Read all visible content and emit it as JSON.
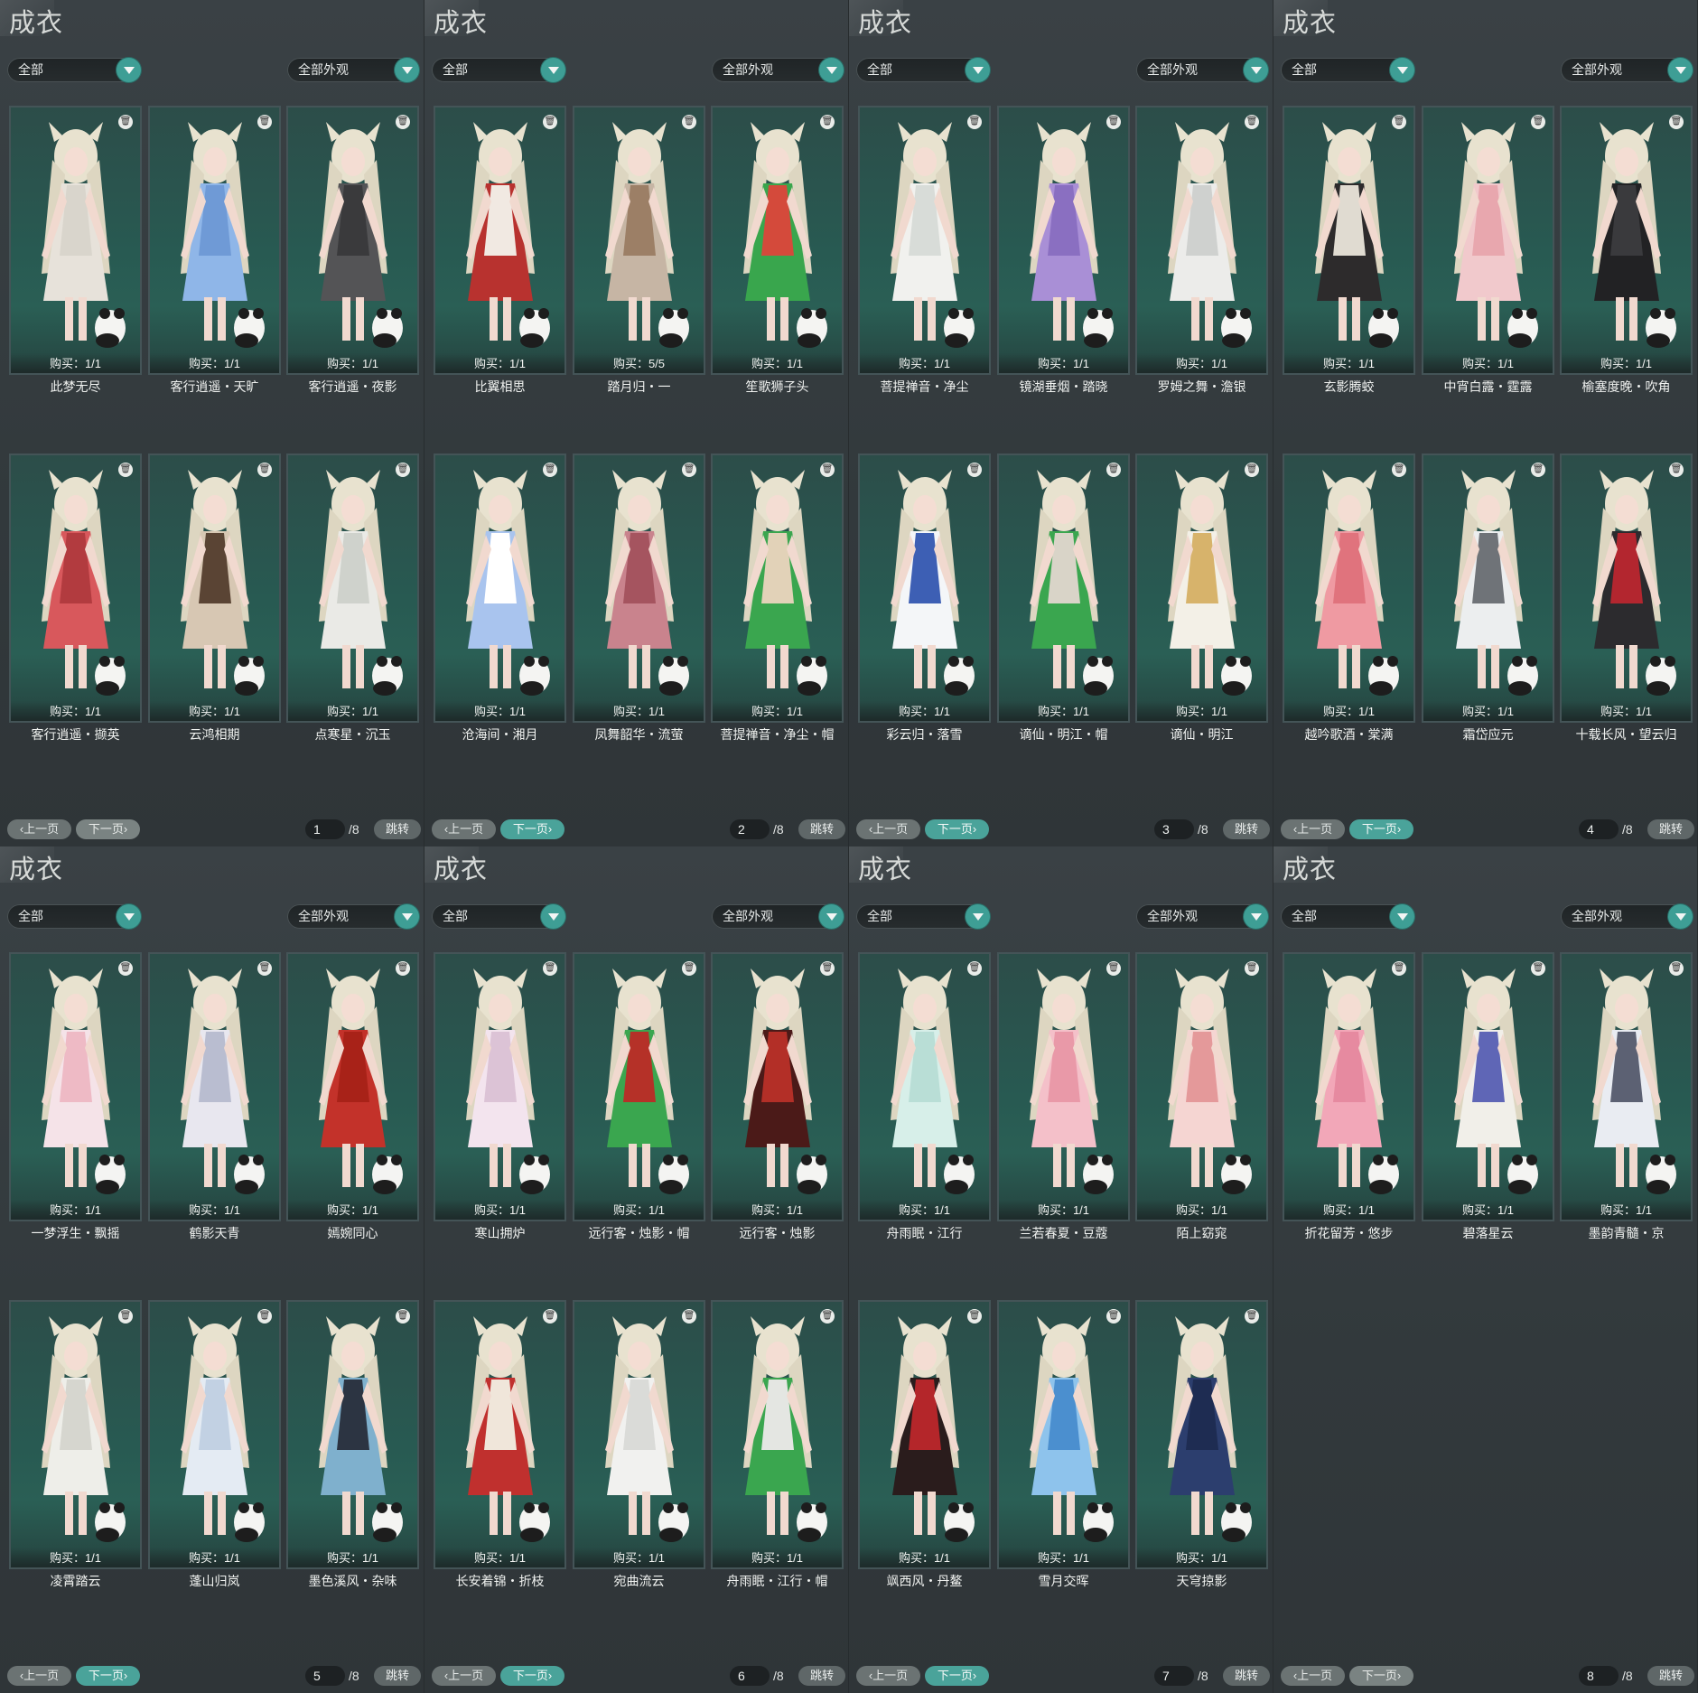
{
  "panels": [
    {
      "title": "成衣",
      "filter_left": "全部",
      "filter_right": "全部外观",
      "prev_label": "上一页",
      "next_label": "下一页",
      "page": "1",
      "total": "/8",
      "jump_label": "跳转",
      "next_active": false,
      "items": [
        {
          "name": "此梦无尽",
          "buy": "购买：1/1",
          "colors": [
            "#e7e2da",
            "#d9d5cc"
          ]
        },
        {
          "name": "客行逍遥・天旷",
          "buy": "购买：1/1",
          "colors": [
            "#8fb6e8",
            "#6f9ad6"
          ]
        },
        {
          "name": "客行逍遥・夜影",
          "buy": "购买：1/1",
          "colors": [
            "#545456",
            "#3a3a3c"
          ]
        },
        {
          "name": "客行逍遥・撷英",
          "buy": "购买：1/1",
          "colors": [
            "#d8585c",
            "#b23b3f"
          ]
        },
        {
          "name": "云鸿相期",
          "buy": "购买：1/1",
          "colors": [
            "#d7c7b3",
            "#5a4434"
          ]
        },
        {
          "name": "点寒星・沉玉",
          "buy": "购买：1/1",
          "colors": [
            "#eaeae6",
            "#cfd2cc"
          ]
        }
      ]
    },
    {
      "title": "成衣",
      "filter_left": "全部",
      "filter_right": "全部外观",
      "prev_label": "上一页",
      "next_label": "下一页",
      "page": "2",
      "total": "/8",
      "jump_label": "跳转",
      "next_active": true,
      "items": [
        {
          "name": "比翼相思",
          "buy": "购买：1/1",
          "colors": [
            "#b8322f",
            "#f1e9e2"
          ]
        },
        {
          "name": "踏月归・一",
          "buy": "购买：5/5",
          "colors": [
            "#c6b5a4",
            "#9c7f66"
          ]
        },
        {
          "name": "笙歌狮子头",
          "buy": "购买：1/1",
          "colors": [
            "#39a64d",
            "#d44a3b"
          ]
        },
        {
          "name": "沧海间・湘月",
          "buy": "购买：1/1",
          "colors": [
            "#a9c4ee",
            "#ffffff"
          ]
        },
        {
          "name": "凤舞韶华・流萤",
          "buy": "购买：1/1",
          "colors": [
            "#c9838d",
            "#a5545f"
          ]
        },
        {
          "name": "菩提禅音・净尘・帽",
          "buy": "购买：1/1",
          "colors": [
            "#3aa64f",
            "#e2d2b8"
          ]
        }
      ]
    },
    {
      "title": "成衣",
      "filter_left": "全部",
      "filter_right": "全部外观",
      "prev_label": "上一页",
      "next_label": "下一页",
      "page": "3",
      "total": "/8",
      "jump_label": "跳转",
      "next_active": true,
      "items": [
        {
          "name": "菩提禅音・净尘",
          "buy": "购买：1/1",
          "colors": [
            "#f1f1ee",
            "#d8dcd8"
          ]
        },
        {
          "name": "镜湖垂烟・踏晓",
          "buy": "购买：1/1",
          "colors": [
            "#a98fd6",
            "#8a6fc1"
          ]
        },
        {
          "name": "罗姆之舞・澹银",
          "buy": "购买：1/1",
          "colors": [
            "#ececea",
            "#cfd1cf"
          ]
        },
        {
          "name": "彩云归・落雪",
          "buy": "购买：1/1",
          "colors": [
            "#f4f6f8",
            "#3d5fb4"
          ]
        },
        {
          "name": "谪仙・明江・帽",
          "buy": "购买：1/1",
          "colors": [
            "#3aa64f",
            "#d9d4c8"
          ]
        },
        {
          "name": "谪仙・明江",
          "buy": "购买：1/1",
          "colors": [
            "#f3f0e7",
            "#d7b36b"
          ]
        }
      ]
    },
    {
      "title": "成衣",
      "filter_left": "全部",
      "filter_right": "全部外观",
      "prev_label": "上一页",
      "next_label": "下一页",
      "page": "4",
      "total": "/8",
      "jump_label": "跳转",
      "next_active": true,
      "items": [
        {
          "name": "玄影腾蛟",
          "buy": "购买：1/1",
          "colors": [
            "#2d2b2c",
            "#e0dbd1"
          ]
        },
        {
          "name": "中宵白露・霆露",
          "buy": "购买：1/1",
          "colors": [
            "#f1c9cc",
            "#e8a7ae"
          ]
        },
        {
          "name": "榆塞度晚・吹角",
          "buy": "购买：1/1",
          "colors": [
            "#222224",
            "#3a3a3d"
          ]
        },
        {
          "name": "越吟歌酒・棠满",
          "buy": "购买：1/1",
          "colors": [
            "#ef9aa2",
            "#e0737d"
          ]
        },
        {
          "name": "霜岱应元",
          "buy": "购买：1/1",
          "colors": [
            "#eceeef",
            "#6f7378"
          ]
        },
        {
          "name": "十载长风・望云归",
          "buy": "购买：1/1",
          "colors": [
            "#2c2b2e",
            "#b3262f"
          ]
        }
      ]
    },
    {
      "title": "成衣",
      "filter_left": "全部",
      "filter_right": "全部外观",
      "prev_label": "上一页",
      "next_label": "下一页",
      "page": "5",
      "total": "/8",
      "jump_label": "跳转",
      "next_active": true,
      "items": [
        {
          "name": "一梦浮生・飘摇",
          "buy": "购买：1/1",
          "colors": [
            "#f5e3e8",
            "#eebac5"
          ]
        },
        {
          "name": "鹤影天青",
          "buy": "购买：1/1",
          "colors": [
            "#e8e7ef",
            "#b9bdd0"
          ]
        },
        {
          "name": "嫣婉同心",
          "buy": "购买：1/1",
          "colors": [
            "#c3322a",
            "#a82218"
          ]
        },
        {
          "name": "凌霄踏云",
          "buy": "购买：1/1",
          "colors": [
            "#eeeee9",
            "#d6d6cf"
          ]
        },
        {
          "name": "蓬山归岚",
          "buy": "购买：1/1",
          "colors": [
            "#e4ebf3",
            "#c2d1e3"
          ]
        },
        {
          "name": "墨色溪风・杂味",
          "buy": "购买：1/1",
          "colors": [
            "#7fb0cd",
            "#2c3442"
          ]
        }
      ]
    },
    {
      "title": "成衣",
      "filter_left": "全部",
      "filter_right": "全部外观",
      "prev_label": "上一页",
      "next_label": "下一页",
      "page": "6",
      "total": "/8",
      "jump_label": "跳转",
      "next_active": true,
      "items": [
        {
          "name": "寒山拥炉",
          "buy": "购买：1/1",
          "colors": [
            "#f3e4ee",
            "#dcc3d6"
          ]
        },
        {
          "name": "远行客・烛影・帽",
          "buy": "购买：1/1",
          "colors": [
            "#3aa64f",
            "#b53128"
          ]
        },
        {
          "name": "远行客・烛影",
          "buy": "购买：1/1",
          "colors": [
            "#4b1a18",
            "#b32f27"
          ]
        },
        {
          "name": "长安着锦・折枝",
          "buy": "购买：1/1",
          "colors": [
            "#c0302e",
            "#f0e6da"
          ]
        },
        {
          "name": "宛曲流云",
          "buy": "购买：1/1",
          "colors": [
            "#f1f1ef",
            "#dadbd8"
          ]
        },
        {
          "name": "舟雨眠・江行・帽",
          "buy": "购买：1/1",
          "colors": [
            "#3aa64f",
            "#e4e6e2"
          ]
        }
      ]
    },
    {
      "title": "成衣",
      "filter_left": "全部",
      "filter_right": "全部外观",
      "prev_label": "上一页",
      "next_label": "下一页",
      "page": "7",
      "total": "/8",
      "jump_label": "跳转",
      "next_active": true,
      "items": [
        {
          "name": "舟雨眠・江行",
          "buy": "购买：1/1",
          "colors": [
            "#d7efe9",
            "#b9ded6"
          ]
        },
        {
          "name": "兰若春夏・豆蔻",
          "buy": "购买：1/1",
          "colors": [
            "#f4c0c9",
            "#e999a8"
          ]
        },
        {
          "name": "陌上窈窕",
          "buy": "购买：1/1",
          "colors": [
            "#f5d5d2",
            "#e4999a"
          ]
        },
        {
          "name": "飒西风・丹鳌",
          "buy": "购买：1/1",
          "colors": [
            "#2a1c1c",
            "#b4262a"
          ]
        },
        {
          "name": "雪月交晖",
          "buy": "购买：1/1",
          "colors": [
            "#8ec3ec",
            "#4b8fcf"
          ]
        },
        {
          "name": "天穹掠影",
          "buy": "购买：1/1",
          "colors": [
            "#2c3e6e",
            "#1e2c52"
          ]
        }
      ]
    },
    {
      "title": "成衣",
      "filter_left": "全部",
      "filter_right": "全部外观",
      "prev_label": "上一页",
      "next_label": "下一页",
      "page": "8",
      "total": "/8",
      "jump_label": "跳转",
      "next_active": false,
      "items": [
        {
          "name": "折花留芳・悠步",
          "buy": "购买：1/1",
          "colors": [
            "#f2a7b8",
            "#e68aa0"
          ]
        },
        {
          "name": "碧落星云",
          "buy": "购买：1/1",
          "colors": [
            "#f1efe9",
            "#5f66b6"
          ]
        },
        {
          "name": "墨韵青髓・京",
          "buy": "购买：1/1",
          "colors": [
            "#e9ecf2",
            "#5c6173"
          ]
        }
      ]
    }
  ]
}
